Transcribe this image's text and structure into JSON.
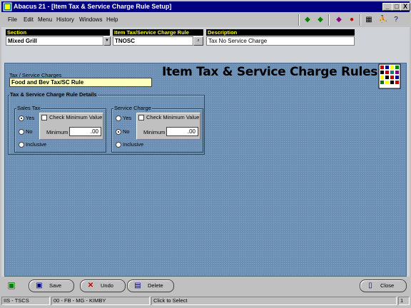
{
  "window": {
    "title": "Abacus 21 - [Item Tax & Service Charge Rule Setup]",
    "min_glyph": "_",
    "max_glyph": "□",
    "close_glyph": "X"
  },
  "menu": {
    "items": [
      "File",
      "Edit",
      "Menu",
      "History",
      "Windows",
      "Help"
    ]
  },
  "header": {
    "section_label": "Section",
    "section_value": "Mixed Grill",
    "rule_label": "Item Tax/Service Charge Rule",
    "rule_value": "TNOSC",
    "description_label": "Description",
    "description_value": "Tax No Service Charge"
  },
  "form": {
    "title": "Item Tax & Service Charge Rules",
    "tax_sc_label": "Tax / Service Charges",
    "tax_sc_value": "Food and Bev Tax/SC Rule",
    "details_label": "Tax & Service Charge Rule Details",
    "sales_tax": {
      "title": "Sales Tax",
      "yes": "Yes",
      "no": "No",
      "inclusive": "Inclusive",
      "check_min": "Check Minimum Value",
      "minimum_label": "Minimum",
      "minimum_value": ".00",
      "selected": "yes"
    },
    "service_charge": {
      "title": "Service Charge",
      "yes": "Yes",
      "no": "No",
      "inclusive": "Inclusive",
      "check_min": "Check Minimum Value",
      "minimum_label": "Minimum",
      "minimum_value": ".00",
      "selected": "no"
    }
  },
  "buttons": {
    "save": "Save",
    "undo": "Undo",
    "delete": "Delete",
    "close": "Close"
  },
  "status": {
    "p1": "IIS - TSCS",
    "p2": "00 - FB - MG - KIMBY",
    "p3": "Click to Select",
    "p4": "1"
  },
  "colors": {
    "titlebar": "#000080",
    "panel": "#6d90b5",
    "header_label_fg": "#ffff00",
    "tax_field_bg": "#ffffc0"
  }
}
